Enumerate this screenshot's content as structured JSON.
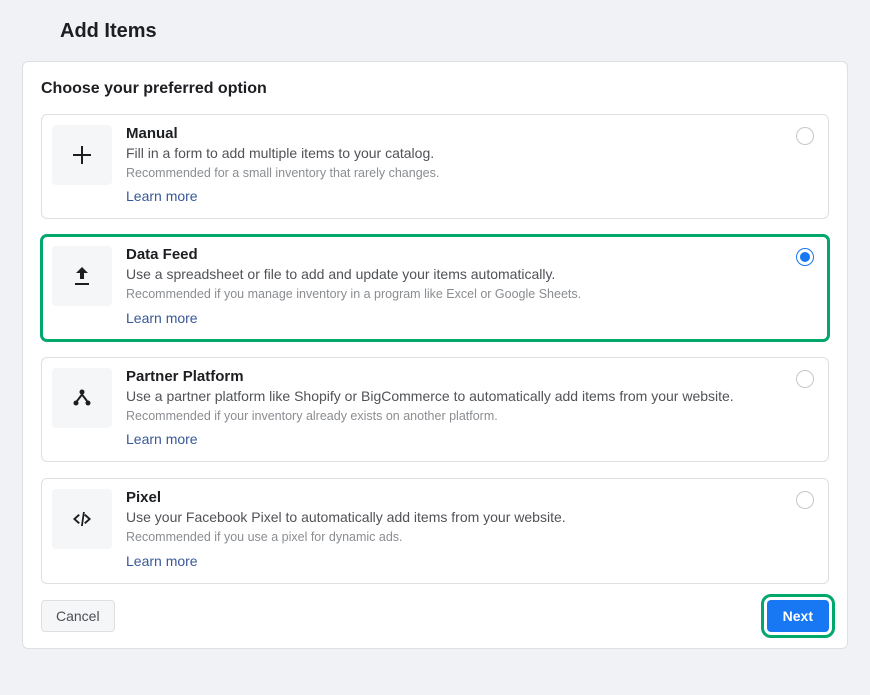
{
  "pageTitle": "Add Items",
  "panelTitle": "Choose your preferred option",
  "options": [
    {
      "id": "manual",
      "title": "Manual",
      "desc": "Fill in a form to add multiple items to your catalog.",
      "hint": "Recommended for a small inventory that rarely changes.",
      "learn": "Learn more",
      "selected": false,
      "highlighted": false,
      "icon": "plus-icon"
    },
    {
      "id": "datafeed",
      "title": "Data Feed",
      "desc": "Use a spreadsheet or file to add and update your items automatically.",
      "hint": "Recommended if you manage inventory in a program like Excel or Google Sheets.",
      "learn": "Learn more",
      "selected": true,
      "highlighted": true,
      "icon": "upload-icon"
    },
    {
      "id": "partner",
      "title": "Partner Platform",
      "desc": "Use a partner platform like Shopify or BigCommerce to automatically add items from your website.",
      "hint": "Recommended if your inventory already exists on another platform.",
      "learn": "Learn more",
      "selected": false,
      "highlighted": false,
      "icon": "nodes-icon"
    },
    {
      "id": "pixel",
      "title": "Pixel",
      "desc": "Use your Facebook Pixel to automatically add items from your website.",
      "hint": "Recommended if you use a pixel for dynamic ads.",
      "learn": "Learn more",
      "selected": false,
      "highlighted": false,
      "icon": "code-icon"
    }
  ],
  "buttons": {
    "cancel": "Cancel",
    "next": "Next"
  }
}
